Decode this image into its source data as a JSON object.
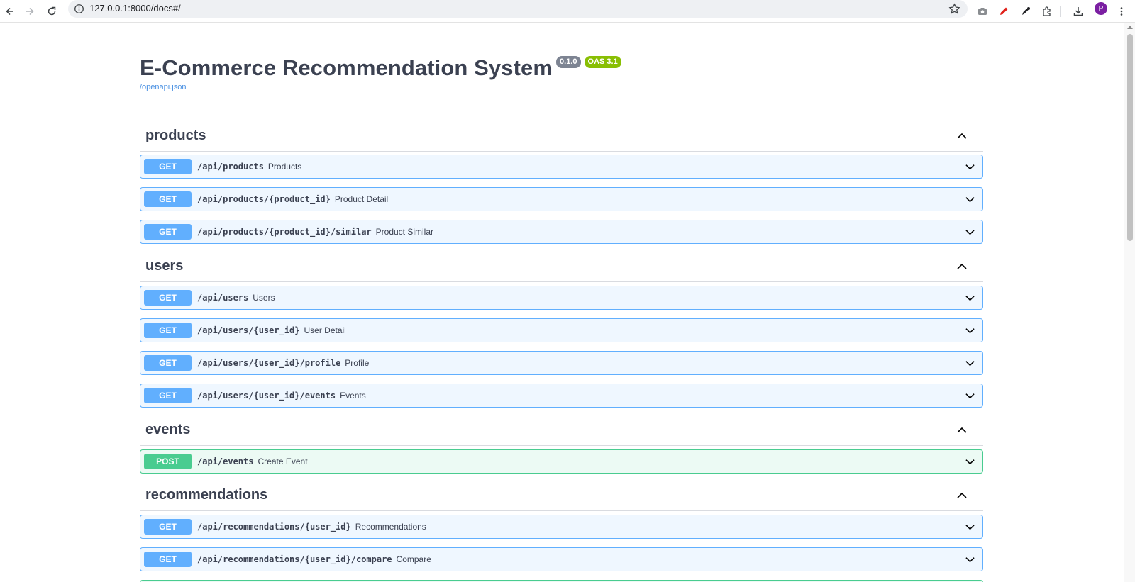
{
  "browser": {
    "url": "127.0.0.1:8000/docs#/",
    "avatar_letter": "P",
    "icons": [
      "back-icon",
      "forward-icon",
      "reload-icon",
      "info-icon",
      "star-icon",
      "camera-icon",
      "pen-icon",
      "eyedropper-icon",
      "extensions-icon",
      "download-icon",
      "menu-icon"
    ]
  },
  "info": {
    "title": "E-Commerce Recommendation System",
    "version": "0.1.0",
    "oas": "OAS 3.1",
    "openapi_link": "/openapi.json"
  },
  "tags": [
    {
      "name": "products",
      "operations": [
        {
          "method": "GET",
          "path": "/api/products",
          "summary": "Products"
        },
        {
          "method": "GET",
          "path": "/api/products/{product_id}",
          "summary": "Product Detail"
        },
        {
          "method": "GET",
          "path": "/api/products/{product_id}/similar",
          "summary": "Product Similar"
        }
      ]
    },
    {
      "name": "users",
      "operations": [
        {
          "method": "GET",
          "path": "/api/users",
          "summary": "Users"
        },
        {
          "method": "GET",
          "path": "/api/users/{user_id}",
          "summary": "User Detail"
        },
        {
          "method": "GET",
          "path": "/api/users/{user_id}/profile",
          "summary": "Profile"
        },
        {
          "method": "GET",
          "path": "/api/users/{user_id}/events",
          "summary": "Events"
        }
      ]
    },
    {
      "name": "events",
      "operations": [
        {
          "method": "POST",
          "path": "/api/events",
          "summary": "Create Event"
        }
      ]
    },
    {
      "name": "recommendations",
      "operations": [
        {
          "method": "GET",
          "path": "/api/recommendations/{user_id}",
          "summary": "Recommendations"
        },
        {
          "method": "GET",
          "path": "/api/recommendations/{user_id}/compare",
          "summary": "Compare"
        }
      ]
    }
  ],
  "colors": {
    "get": "#61affe",
    "post": "#49cc90",
    "text": "#3b4151",
    "link": "#4990e2"
  }
}
